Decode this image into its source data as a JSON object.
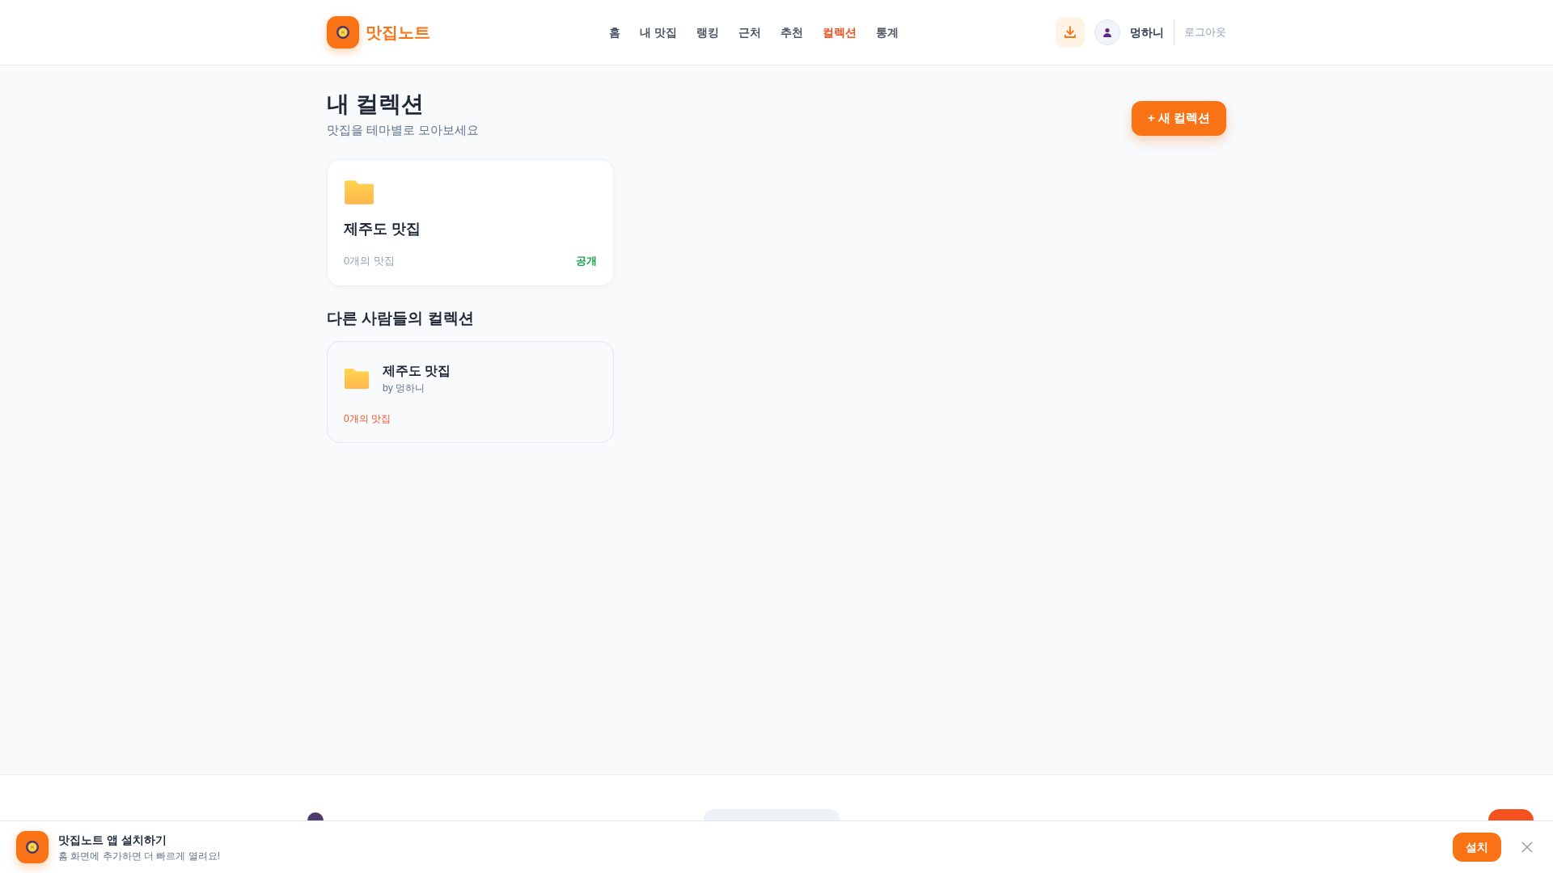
{
  "header": {
    "logo_text": "맛집노트",
    "nav": [
      {
        "label": "홈",
        "selected": false
      },
      {
        "label": "내 맛집",
        "selected": false
      },
      {
        "label": "랭킹",
        "selected": false
      },
      {
        "label": "근처",
        "selected": false
      },
      {
        "label": "추천",
        "selected": false
      },
      {
        "label": "컬렉션",
        "selected": true
      },
      {
        "label": "통계",
        "selected": false
      }
    ],
    "user_name": "멍하니",
    "logout": "로그아웃"
  },
  "page": {
    "title": "내 컬렉션",
    "subtitle": "맛집을 테마별로 모아보세요",
    "new_button": "+ 새 컬렉션"
  },
  "my_collections": [
    {
      "name": "제주도 맛집",
      "count": "0개의 맛집",
      "visibility": "공개"
    }
  ],
  "others_heading": "다른 사람들의 컬렉션",
  "other_collections": [
    {
      "name": "제주도 맛집",
      "owner": "by 멍하니",
      "count": "0개의 맛집"
    }
  ],
  "install_banner": {
    "title": "맛집노트 앱 설치하기",
    "subtitle": "홈 화면에 추가하면 더 빠르게 열려요!",
    "button": "설치"
  }
}
